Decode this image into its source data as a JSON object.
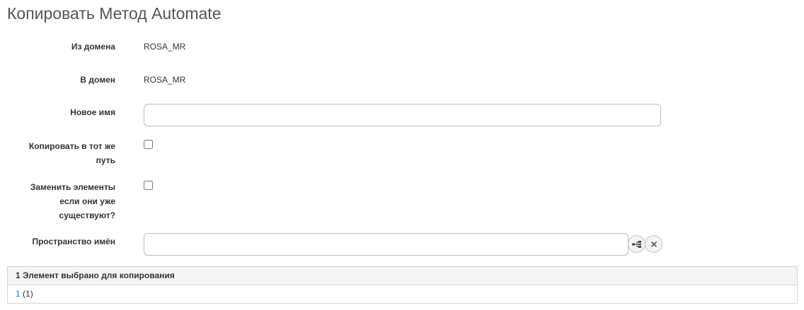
{
  "page_title": "Копировать Метод Automate",
  "form": {
    "from_domain": {
      "label": "Из домена",
      "value": "ROSA_MR"
    },
    "to_domain": {
      "label": "В домен",
      "value": "ROSA_MR"
    },
    "new_name": {
      "label": "Новое имя",
      "value": "",
      "placeholder": ""
    },
    "copy_same_path": {
      "label_line1": "Копировать в тот же",
      "label_line2": "путь",
      "checked": false
    },
    "override_existing": {
      "label_line1": "Заменить элементы",
      "label_line2": "если они уже",
      "label_line3": "существуют?",
      "checked": false
    },
    "namespace": {
      "label": "Пространство имён",
      "value": "",
      "placeholder": "",
      "select_icon": "tree-select-icon",
      "clear_icon": "close-icon"
    }
  },
  "selected_items": {
    "header": "1 Элемент выбрано для копирования",
    "items": [
      {
        "link": "1",
        "count": " (1)"
      }
    ]
  }
}
